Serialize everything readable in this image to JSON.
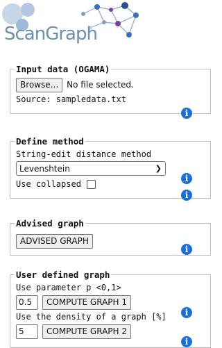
{
  "logo": {
    "text": "ScanGraph"
  },
  "input_panel": {
    "legend": "Input data (OGAMA)",
    "browse_label": "Browse...",
    "file_status": "No file selected.",
    "source_text": "Source: sampledata.txt",
    "info": "i"
  },
  "method_panel": {
    "legend": "Define method",
    "method_label": "String-edit distance method",
    "method_value": "Levenshtein",
    "collapsed_label": "Use collapsed",
    "info": "i"
  },
  "advised_panel": {
    "legend": "Advised graph",
    "button_label": "ADVISED GRAPH",
    "info": "i"
  },
  "user_panel": {
    "legend": "User defined graph",
    "param_label": "Use parameter p <0,1>",
    "param_value": "0.5",
    "compute1_label": "COMPUTE GRAPH 1",
    "density_label": "Use the density of a graph [%]",
    "density_value": "5",
    "compute2_label": "COMPUTE GRAPH 2",
    "info": "i"
  },
  "colors": {
    "accent": "#1a6fe0",
    "logo": "#6a8fb0",
    "nodes": [
      "#7f9cc4",
      "#3d6ebf",
      "#7b3f9e",
      "#c0d3e8"
    ]
  }
}
